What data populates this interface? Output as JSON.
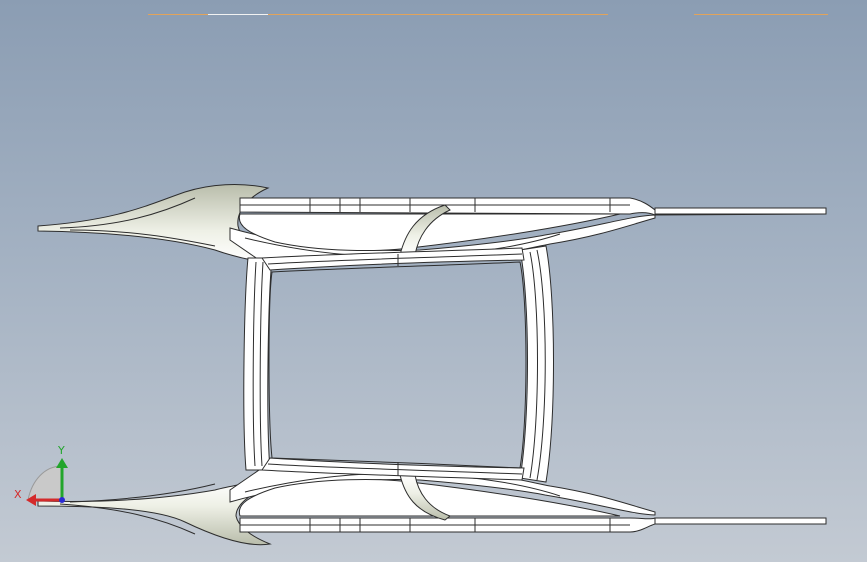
{
  "viewport": {
    "background_top": "#8b9db3",
    "background_bottom": "#c3cad3",
    "accent_line_color": "#d99a4e"
  },
  "model": {
    "name": "car-chassis-frame-wireframe",
    "fill_color": "#ffffff",
    "edge_color": "#2d2d2d",
    "shade_color": "#cfd3c2"
  },
  "triad": {
    "x_label": "X",
    "y_label": "Y",
    "x_color": "#d42a2a",
    "y_color": "#22a52c",
    "z_color": "#2a2ad4"
  }
}
